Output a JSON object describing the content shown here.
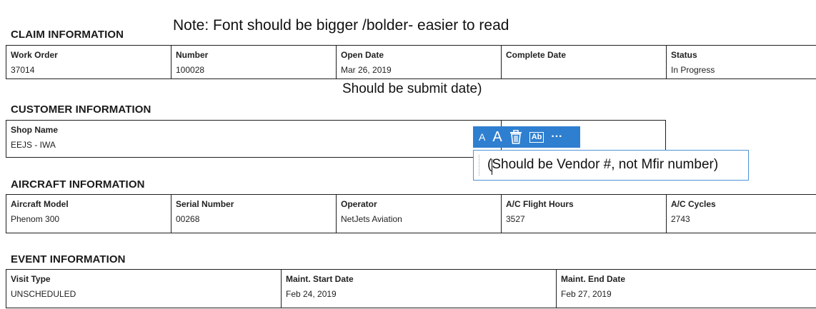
{
  "notes": {
    "font_note": "Note: Font should be bigger /bolder- easier to read",
    "submit_date_note": "Should be submit date)",
    "vendor_note": "(Should be Vendor #, not Mfir number)"
  },
  "claim": {
    "title": "CLAIM INFORMATION",
    "fields": [
      {
        "label": "Work Order",
        "value": "37014"
      },
      {
        "label": "Number",
        "value": "100028"
      },
      {
        "label": "Open Date",
        "value": "Mar 26, 2019"
      },
      {
        "label": "Complete Date",
        "value": ""
      },
      {
        "label": "Status",
        "value": "In Progress"
      }
    ]
  },
  "customer": {
    "title": "CUSTOMER INFORMATION",
    "fields": [
      {
        "label": "Shop Name",
        "value": "EEJS - IWA"
      }
    ]
  },
  "aircraft": {
    "title": "AIRCRAFT INFORMATION",
    "fields": [
      {
        "label": "Aircraft Model",
        "value": "Phenom 300"
      },
      {
        "label": "Serial Number",
        "value": "00268"
      },
      {
        "label": "Operator",
        "value": "NetJets Aviation"
      },
      {
        "label": "A/C Flight Hours",
        "value": "3527"
      },
      {
        "label": "A/C Cycles",
        "value": "2743"
      }
    ]
  },
  "event": {
    "title": "EVENT INFORMATION",
    "fields": [
      {
        "label": "Visit Type",
        "value": "UNSCHEDULED"
      },
      {
        "label": "Maint. Start Date",
        "value": "Feb 24, 2019"
      },
      {
        "label": "Maint. End Date",
        "value": "Feb 27, 2019"
      }
    ]
  },
  "toolbar": {
    "icons": [
      "font-size-decrease-icon",
      "font-size-increase-icon",
      "trash-icon",
      "text-style-icon",
      "more-options-icon"
    ],
    "small_a": "A",
    "large_a": "A",
    "text_style": "Ab",
    "more": "···",
    "color": "#2f7fd0"
  }
}
